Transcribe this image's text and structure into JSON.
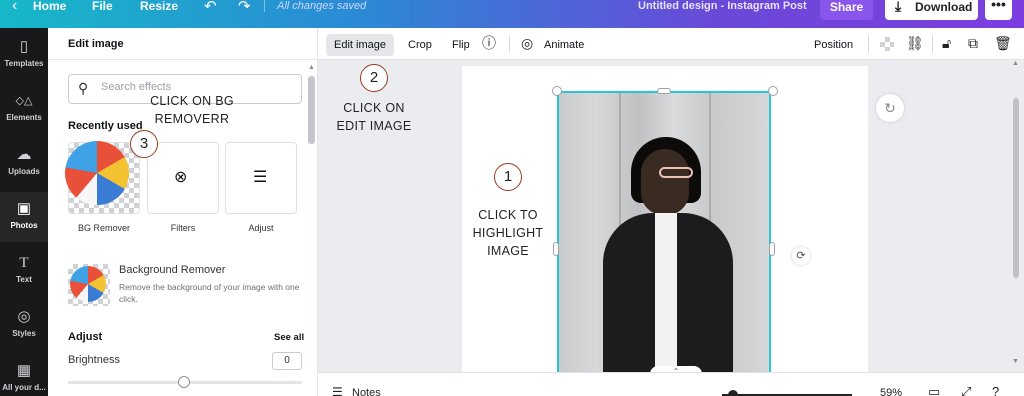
{
  "topbar": {
    "home": "Home",
    "file": "File",
    "resize": "Resize",
    "saved_status": "All changes saved",
    "design_title": "Untitled design - Instagram Post",
    "share": "Share",
    "download": "Download",
    "more": "•••",
    "undo_icon": "undo-icon",
    "redo_icon": "redo-icon"
  },
  "rail": {
    "items": [
      {
        "label": "Templates",
        "icon": "▯"
      },
      {
        "label": "Elements",
        "icon": "◇△"
      },
      {
        "label": "Uploads",
        "icon": "☁"
      },
      {
        "label": "Photos",
        "icon": "▣"
      },
      {
        "label": "Text",
        "icon": "T"
      },
      {
        "label": "Styles",
        "icon": "◎"
      },
      {
        "label": "All your d...",
        "icon": "▦"
      }
    ]
  },
  "panel": {
    "title": "Edit image",
    "search_placeholder": "Search effects",
    "recently_used": "Recently used",
    "cards": [
      "BG Remover",
      "Filters",
      "Adjust"
    ],
    "bg_remover_title": "Background Remover",
    "bg_remover_desc": "Remove the background of your image with one click.",
    "adjust_title": "Adjust",
    "see_all": "See all",
    "brightness_label": "Brightness",
    "brightness_value": "0"
  },
  "toolbar": {
    "edit_image": "Edit image",
    "crop": "Crop",
    "flip": "Flip",
    "info": "ⓘ",
    "animate": "Animate",
    "position": "Position"
  },
  "bottombar": {
    "notes": "Notes",
    "zoom": "59%"
  },
  "annotations": {
    "step1_num": "1",
    "step1_text": "CLICK TO HIGHLIGHT IMAGE",
    "step2_num": "2",
    "step2_text": "CLICK ON EDIT IMAGE",
    "step3_num": "3",
    "step3_text": "CLICK ON BG REMOVERR"
  },
  "colors": {
    "topbar_gradient_start": "#17b8c8",
    "topbar_gradient_end": "#7d3ee0",
    "selection": "#2ec4d8",
    "share_button": "#8a55ea",
    "rail": "#18191b"
  }
}
